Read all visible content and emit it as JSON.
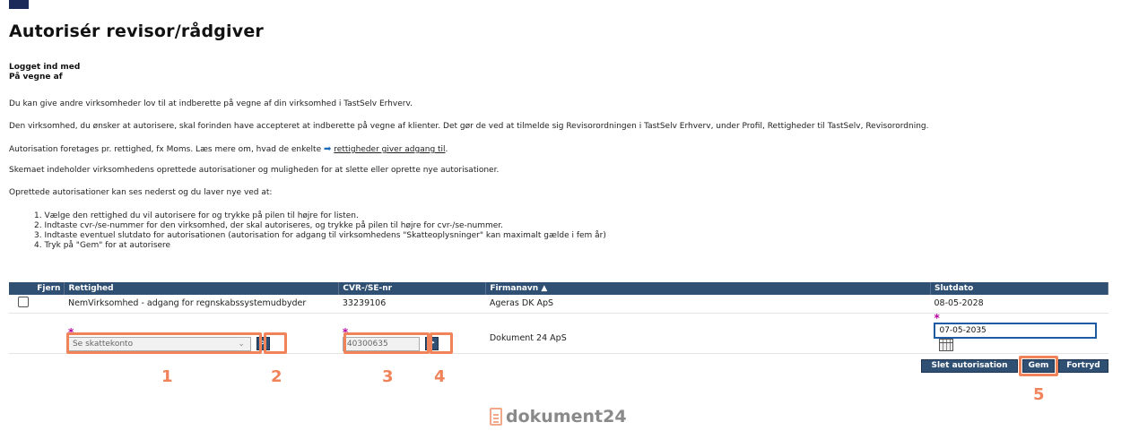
{
  "page": {
    "title": "Autorisér revisor/rådgiver",
    "login_label": "Logget ind med",
    "on_behalf_label": "På vegne af"
  },
  "intro": {
    "p1": "Du kan give andre virksomheder lov til at indberette på vegne af din virksomhed i TastSelv Erhverv.",
    "p2": "Den virksomhed, du ønsker at autorisere, skal forinden have accepteret at indberette på vegne af klienter. Det gør de ved at tilmelde sig Revisorordningen i TastSelv Erhverv, under Profil, Rettigheder til TastSelv, Revisorordning.",
    "p3_before": "Autorisation foretages pr. rettighed, fx Moms. Læs mere om, hvad de enkelte",
    "p3_link": "rettigheder giver adgang til",
    "p3_after": ".",
    "p4": "Skemaet indeholder virksomhedens oprettede autorisationer og muligheden for at slette eller oprette nye autorisationer.",
    "p5": "Oprettede autorisationer kan ses nederst og du laver nye ved at:"
  },
  "steps": [
    "1. Vælge den rettighed du vil autorisere for og trykke på pilen til højre for listen.",
    "2. Indtaste cvr-/se-nummer for den virksomhed, der skal autoriseres, og trykke på pilen til højre for cvr-/se-nummer.",
    "3. Indtaste eventuel slutdato for autorisationen (autorisation for adgang til virksomhedens \"Skatteoplysninger\" kan maximalt gælde i fem år)",
    "4. Tryk på \"Gem\" for at autorisere"
  ],
  "table": {
    "headers": {
      "remove": "Fjern",
      "right": "Rettighed",
      "cvr": "CVR-/SE-nr",
      "company": "Firmanavn ▲",
      "end_date": "Slutdato"
    },
    "rows": [
      {
        "right": "NemVirksomhed - adgang for regnskabssystemudbyder",
        "cvr": "33239106",
        "company": "Ageras DK ApS",
        "end_date": "08-05-2028"
      }
    ],
    "new_entry": {
      "required_mark": "*",
      "right_select": "Se skattekonto",
      "go_label": ">",
      "cvr_value": "40300635",
      "company": "Dokument 24 ApS",
      "end_date_value": "07-05-2035"
    }
  },
  "actions": {
    "delete": "Slet autorisation",
    "save": "Gem",
    "cancel": "Fortryd"
  },
  "annotations": [
    "1",
    "2",
    "3",
    "4",
    "5"
  ],
  "watermark": "dokument24",
  "colors": {
    "header_bg": "#2f4f73",
    "highlight": "#f0835a",
    "required": "#b4009e",
    "focus_border": "#1f5aa5"
  },
  "icons": {
    "calendar": "calendar-icon",
    "arrow": "arrow-right-icon",
    "select": "chevron-down-icon"
  }
}
